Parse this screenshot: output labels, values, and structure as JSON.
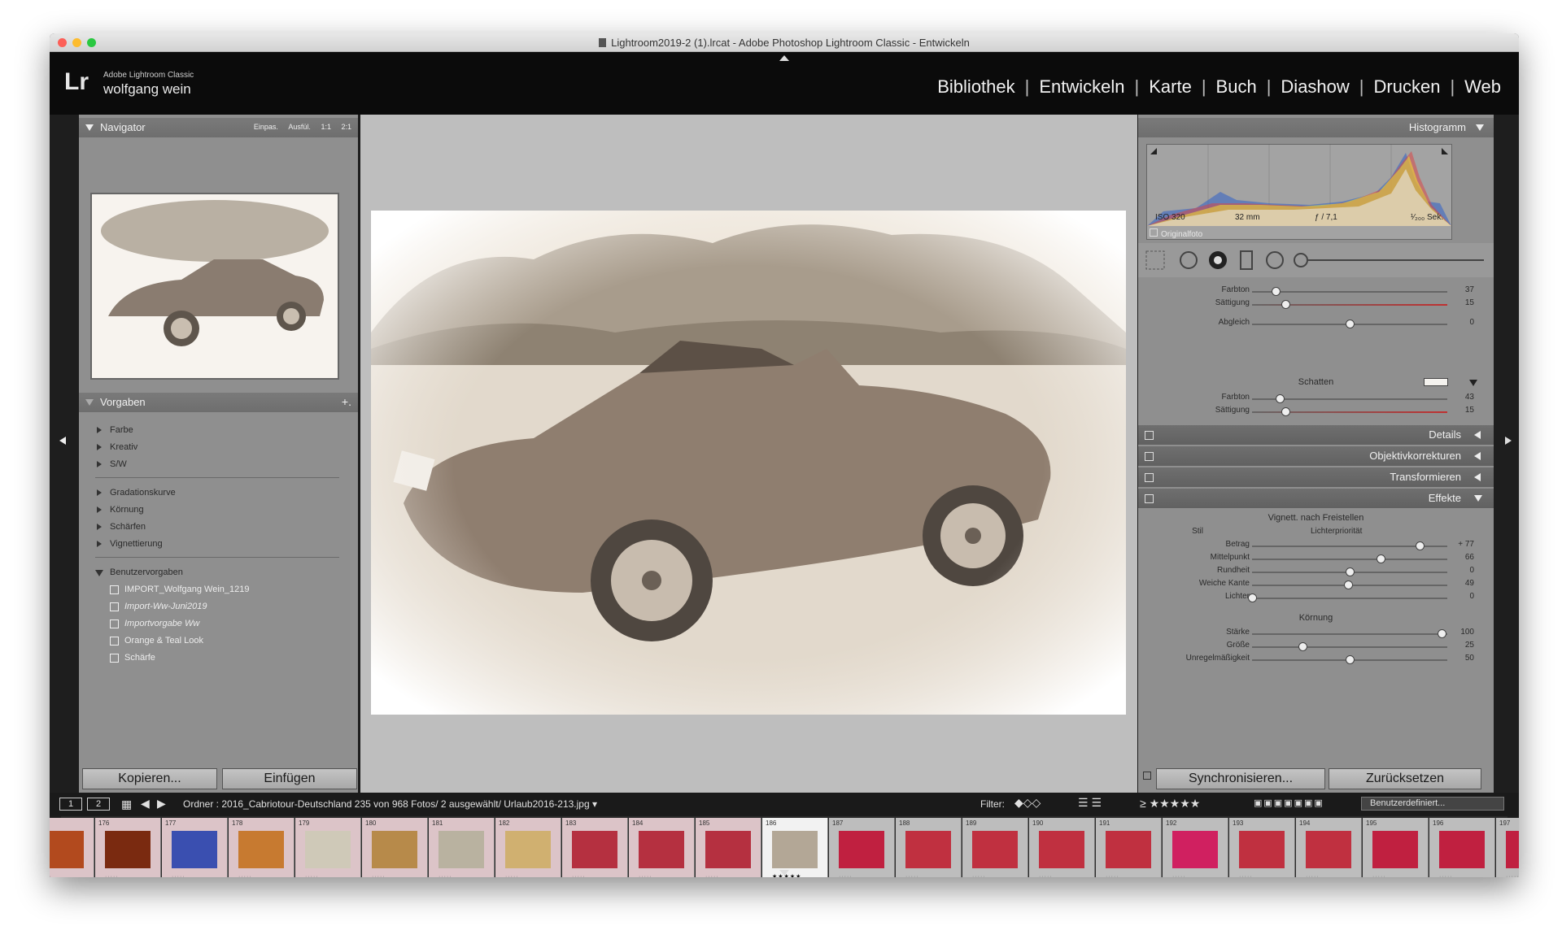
{
  "window": {
    "title": "Lightroom2019-2 (1).lrcat - Adobe Photoshop Lightroom Classic - Entwickeln"
  },
  "identity": {
    "logo": "Lr",
    "product": "Adobe Lightroom Classic",
    "user": "wolfgang wein"
  },
  "modules": [
    "Bibliothek",
    "Entwickeln",
    "Karte",
    "Buch",
    "Diashow",
    "Drucken",
    "Web"
  ],
  "navigator": {
    "title": "Navigator",
    "zoom": [
      "Einpas.",
      "Ausfül.",
      "1:1",
      "2:1"
    ]
  },
  "presets": {
    "title": "Vorgaben",
    "add": "+.",
    "group1": [
      "Farbe",
      "Kreativ",
      "S/W"
    ],
    "group2": [
      "Gradationskurve",
      "Körnung",
      "Schärfen",
      "Vignettierung"
    ],
    "user_group": "Benutzervorgaben",
    "user_items": [
      "IMPORT_Wolfgang Wein_1219",
      "Import-Ww-Juni2019",
      "Importvorgabe Ww",
      "Orange & Teal Look",
      "Schärfe"
    ]
  },
  "left_buttons": {
    "copy": "Kopieren...",
    "paste": "Einfügen"
  },
  "histogram": {
    "title": "Histogramm",
    "iso": "ISO 320",
    "focal": "32 mm",
    "aperture": "ƒ / 7,1",
    "shutter": "¹⁄₂₀₀ Sek.",
    "original": "Originalfoto"
  },
  "split_toning": {
    "rows": [
      {
        "label": "Farbton",
        "value": "37",
        "pos": 0.12
      },
      {
        "label": "Sättigung",
        "value": "15",
        "pos": 0.17
      }
    ],
    "balance": {
      "label": "Abgleich",
      "value": "0",
      "pos": 0.5
    },
    "shadows_title": "Schatten",
    "shadow_rows": [
      {
        "label": "Farbton",
        "value": "43",
        "pos": 0.14
      },
      {
        "label": "Sättigung",
        "value": "15",
        "pos": 0.17
      }
    ]
  },
  "sections": {
    "details": "Details",
    "lens": "Objektivkorrekturen",
    "transform": "Transformieren",
    "effects": "Effekte"
  },
  "effects": {
    "vignette_title": "Vignett. nach Freistellen",
    "style_label": "Stil",
    "style_value": "Lichterpriorität",
    "vignette_rows": [
      {
        "label": "Betrag",
        "value": "+ 77",
        "pos": 0.86
      },
      {
        "label": "Mittelpunkt",
        "value": "66",
        "pos": 0.66
      },
      {
        "label": "Rundheit",
        "value": "0",
        "pos": 0.5
      },
      {
        "label": "Weiche Kante",
        "value": "49",
        "pos": 0.49
      },
      {
        "label": "Lichter",
        "value": "0",
        "pos": 0.0
      }
    ],
    "grain_title": "Körnung",
    "grain_rows": [
      {
        "label": "Stärke",
        "value": "100",
        "pos": 0.97
      },
      {
        "label": "Größe",
        "value": "25",
        "pos": 0.26
      },
      {
        "label": "Unregelmäßigkeit",
        "value": "50",
        "pos": 0.5
      }
    ]
  },
  "right_buttons": {
    "sync": "Synchronisieren...",
    "reset": "Zurücksetzen"
  },
  "filmstrip_bar": {
    "view1": "1",
    "view2": "2",
    "source": "Ordner : 2016_Cabriotour-Deutschland  235 von 968 Fotos/ 2 ausgewählt/ Urlaub2016-213.jpg",
    "filter_label": "Filter:",
    "rating_filter": "≥ ★★★★★",
    "custom": "Benutzerdefiniert..."
  },
  "filmstrip": [
    {
      "n": "",
      "c": "#b24a1e"
    },
    {
      "n": "176",
      "c": "#7a2a10"
    },
    {
      "n": "177",
      "c": "#3a4fb0"
    },
    {
      "n": "178",
      "c": "#c77a30"
    },
    {
      "n": "179",
      "c": "#cfc9b8"
    },
    {
      "n": "180",
      "c": "#b78a4a"
    },
    {
      "n": "181",
      "c": "#b9b2a0"
    },
    {
      "n": "182",
      "c": "#d0b070"
    },
    {
      "n": "183",
      "c": "#b53040"
    },
    {
      "n": "184",
      "c": "#b53040"
    },
    {
      "n": "185",
      "c": "#b53040"
    },
    {
      "n": "186",
      "c": "#b3a796"
    },
    {
      "n": "187",
      "c": "#c02040"
    },
    {
      "n": "188",
      "c": "#c03040"
    },
    {
      "n": "189",
      "c": "#c03040"
    },
    {
      "n": "190",
      "c": "#c03040"
    },
    {
      "n": "191",
      "c": "#c03040"
    },
    {
      "n": "192",
      "c": "#d02060"
    },
    {
      "n": "193",
      "c": "#c03040"
    },
    {
      "n": "194",
      "c": "#c03040"
    },
    {
      "n": "195",
      "c": "#c02040"
    },
    {
      "n": "196",
      "c": "#c02040"
    },
    {
      "n": "197",
      "c": "#c02040"
    }
  ],
  "filmstrip_selected_stars": "★★★★★",
  "colors": {
    "panel": "#8f8f8f",
    "center": "#bebebe",
    "header": "#0b0b0b"
  }
}
